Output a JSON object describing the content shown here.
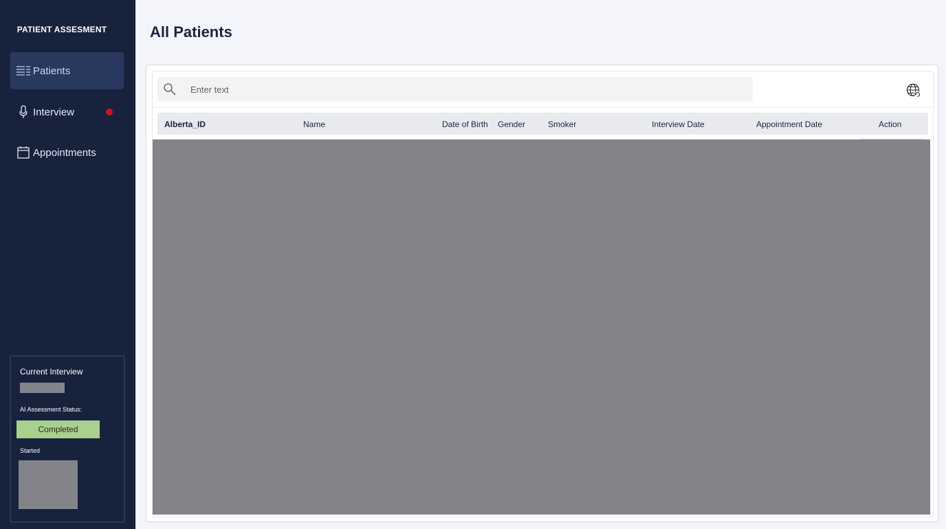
{
  "sidebar": {
    "brand": "PATIENT ASSESMENT",
    "items": [
      {
        "label": "Patients",
        "icon": "list-icon",
        "active": true
      },
      {
        "label": "Interview",
        "icon": "microphone-icon",
        "has_dot": true
      },
      {
        "label": "Appointments",
        "icon": "calendar-icon"
      }
    ],
    "status_panel": {
      "title": "Current Interview",
      "ai_status_label": "AI Assessment Status:",
      "ai_status_value": "Completed",
      "started_label": "Started"
    }
  },
  "main": {
    "title": "All Patients",
    "search": {
      "placeholder": "Enter text",
      "icon": "search-icon"
    },
    "refresh_icon": "globe-refresh-icon",
    "table": {
      "columns": [
        "Alberta_ID",
        "Name",
        "Date of Birth",
        "Gender",
        "Smoker",
        "Interview Date",
        "Appointment Date",
        "Action"
      ]
    }
  },
  "colors": {
    "sidebar_bg": "#17223d",
    "active_item_bg": "#29385f",
    "notification_dot": "#d4121b",
    "status_completed": "#a9d08e",
    "redacted": "#83848a",
    "page_bg": "#f4f5fa"
  }
}
